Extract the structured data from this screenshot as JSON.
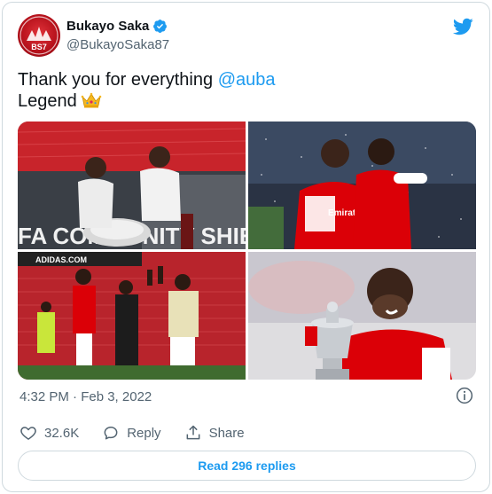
{
  "author": {
    "name": "Bukayo Saka",
    "handle": "@BukayoSaka87",
    "avatar_text": "BS7"
  },
  "tweet": {
    "text_line1": "Thank you for everything",
    "mention": "@auba",
    "text_line2": "Legend",
    "emoji": "crown-emoji"
  },
  "timestamp": "4:32 PM · Feb 3, 2022",
  "actions": {
    "likes_count": "32.6K",
    "reply_label": "Reply",
    "share_label": "Share"
  },
  "replies_button": "Read 296 replies",
  "photo_text": {
    "photo1": "FA COMMUNITY SHIELD",
    "photo2": "Emirates",
    "photo3": "ADIDAS.COM"
  },
  "colors": {
    "accent": "#1d9bf0",
    "text": "#0f1419",
    "muted": "#536471",
    "border": "#cfd9de",
    "arsenal_red": "#db0007"
  }
}
